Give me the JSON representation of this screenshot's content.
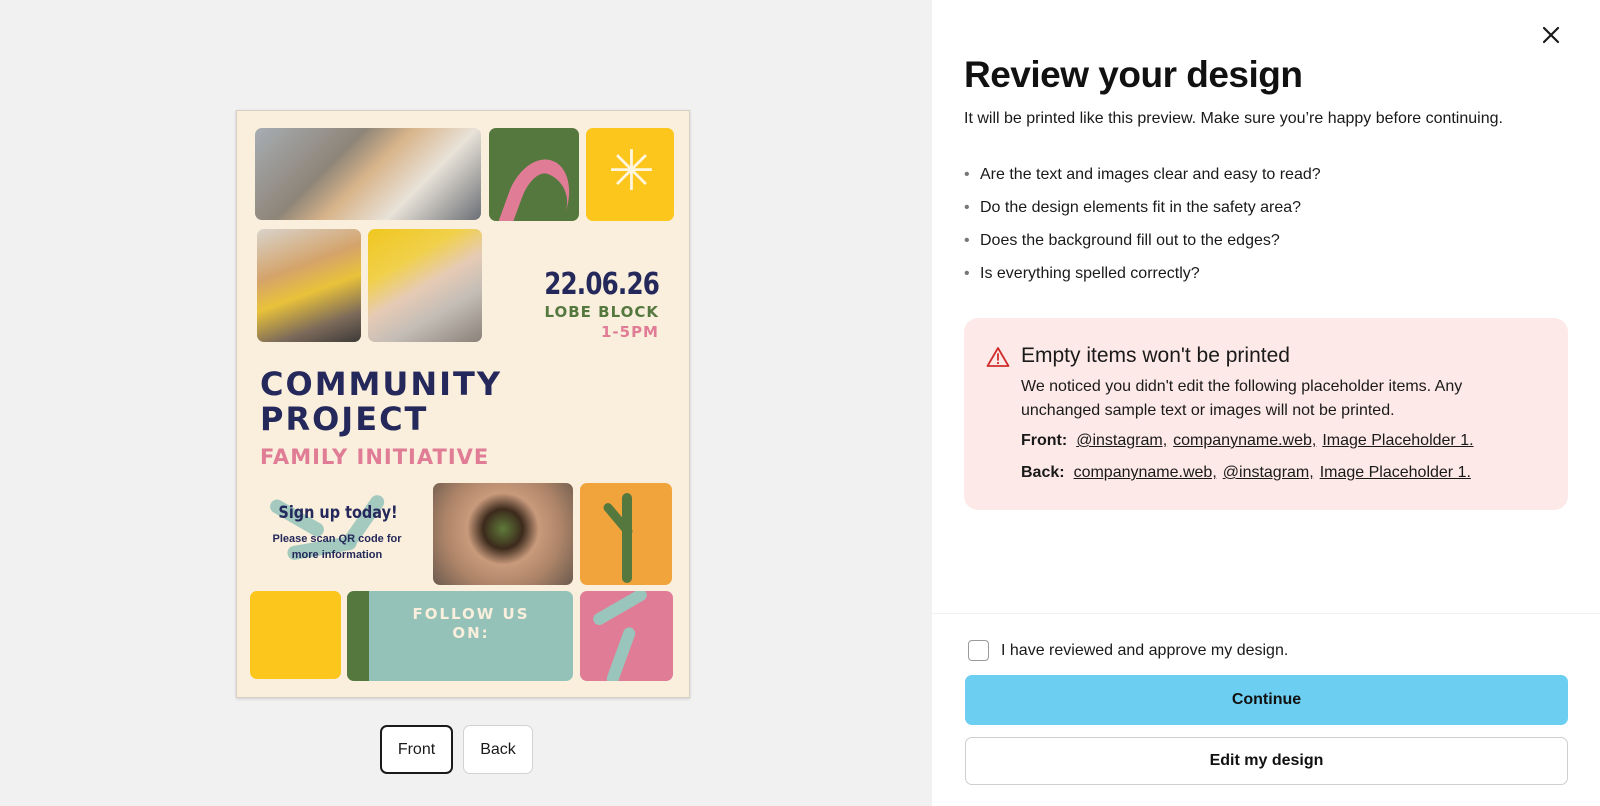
{
  "preview": {
    "flyer": {
      "date": "22.06.26",
      "location": "LOBE BLOCK",
      "time": "1-5PM",
      "title_line1": "COMMUNITY",
      "title_line2": "PROJECT",
      "subtitle": "FAMILY INITIATIVE",
      "signup_title": "Sign up today!",
      "signup_text": "Please scan QR code for more information",
      "follow_line1": "FOLLOW US",
      "follow_line2": "ON:"
    },
    "sides": {
      "front_label": "Front",
      "back_label": "Back",
      "selected": "Front"
    }
  },
  "panel": {
    "title": "Review your design",
    "intro": "It will be printed like this preview. Make sure you’re happy before continuing.",
    "checklist": [
      "Are the text and images clear and easy to read?",
      "Do the design elements fit in the safety area?",
      "Does the background fill out to the edges?",
      "Is everything spelled correctly?"
    ],
    "alert": {
      "title": "Empty items won't be printed",
      "body": "We noticed you didn't edit the following placeholder items. Any unchanged sample text or images will not be printed.",
      "front_label": "Front:",
      "front_items": [
        "@instagram,",
        "companyname.web,",
        "Image Placeholder 1."
      ],
      "back_label": "Back:",
      "back_items": [
        "companyname.web,",
        "@instagram,",
        "Image Placeholder 1."
      ]
    },
    "approve_label": "I have reviewed and approve my design.",
    "continue_label": "Continue",
    "edit_label": "Edit my design"
  },
  "colors": {
    "accent": "#6ccff1",
    "alert_bg": "#fde9e7",
    "alert_icon": "#d12c2c",
    "flyer_navy": "#25285a",
    "flyer_pink": "#e07c96",
    "flyer_green": "#55783f"
  }
}
